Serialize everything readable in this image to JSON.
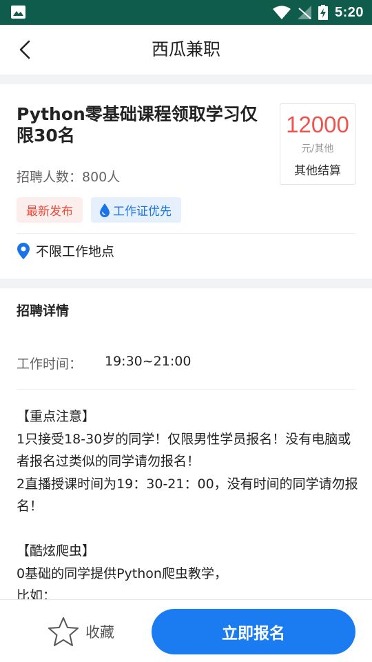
{
  "status_bar": {
    "time": "5:20"
  },
  "header": {
    "title": "西瓜兼职"
  },
  "job": {
    "title": "Python零基础课程领取学习仅限30名",
    "salary": {
      "amount": "12000",
      "unit": "元/其他",
      "settlement": "其他结算"
    },
    "headcount": "招聘人数：800人",
    "tags": {
      "new": "最新发布",
      "cert": "工作证优先"
    },
    "location": "不限工作地点"
  },
  "detail": {
    "title": "招聘详情",
    "work_time_label": "工作时间：",
    "work_time_value": "19:30~21:00",
    "lines": [
      "【重点注意】",
      "1只接受18-30岁的同学！仅限男性学员报名！没有电脑或者报名过类似的同学请勿报名！",
      "2直播授课时间为19：30-21：00，没有时间的同学请勿报名！",
      "",
      "【酷炫爬虫】",
      "0基础的同学提供Python爬虫教学，",
      "比如："
    ]
  },
  "bottom": {
    "favorite_label": "收藏",
    "apply_label": "立即报名"
  },
  "colors": {
    "status_bar": "#0f5b4c",
    "accent": "#1b7cf2",
    "salary": "#ef5350"
  }
}
